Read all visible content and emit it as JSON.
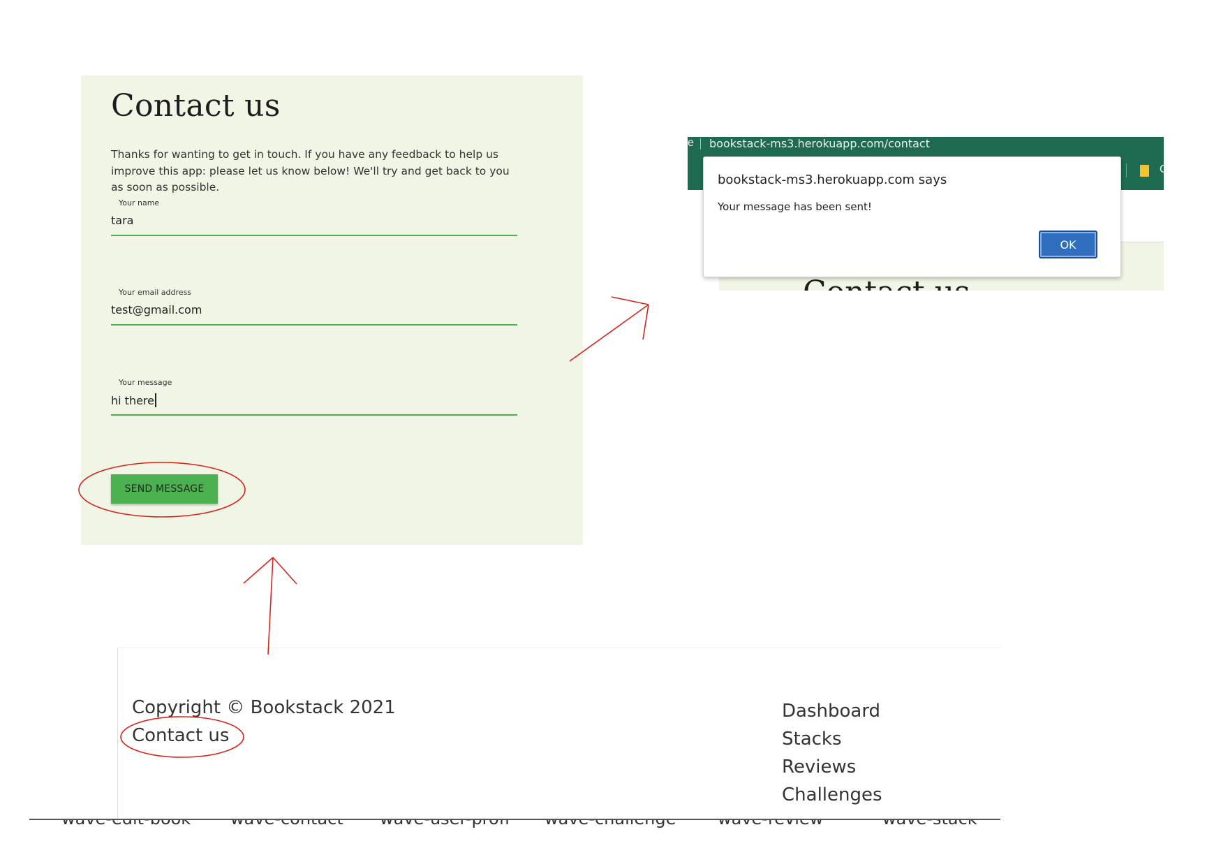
{
  "contact_form": {
    "title": "Contact us",
    "intro": "Thanks for wanting to get in touch. If you have any feedback to help us improve this app: please let us know below! We'll try and get back to you as soon as possible.",
    "name_label": "Your name",
    "name_value": "tara",
    "email_label": "Your email address",
    "email_value": "test@gmail.com",
    "message_label": "Your message",
    "message_value": "hi there",
    "send_button": "SEND MESSAGE"
  },
  "alert_screenshot": {
    "url": "bookstack-ms3.herokuapp.com/contact",
    "url_prefix": "e",
    "toolbar_edge_text": "C",
    "dialog_title": "bookstack-ms3.herokuapp.com says",
    "dialog_message": "Your message has been sent!",
    "ok_button": "OK",
    "page_title_behind": "Contact us"
  },
  "footer_screenshot": {
    "copyright": "Copyright © Bookstack 2021",
    "contact_link": "Contact us",
    "nav_links": [
      "Dashboard",
      "Stacks",
      "Reviews",
      "Challenges"
    ],
    "file_tabs": [
      "wave-edit-book",
      "wave-contact",
      "wave-user-profi",
      "wave-challenge",
      "wave-review",
      "wave-stack"
    ]
  },
  "annotation_color": "#d9241b",
  "accent_green": "#4caf50"
}
